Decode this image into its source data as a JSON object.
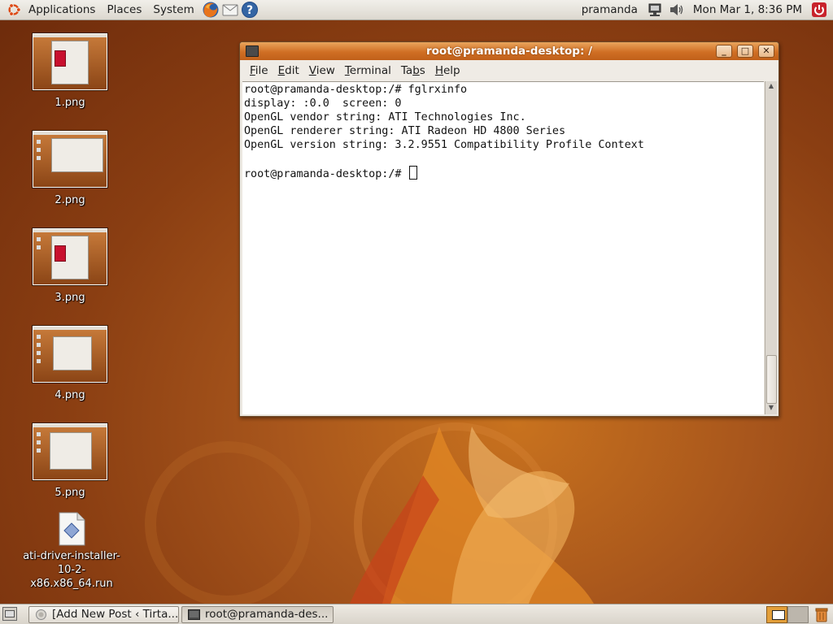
{
  "top_panel": {
    "menus": [
      "Applications",
      "Places",
      "System"
    ],
    "launchers": [
      "firefox-icon",
      "mail-icon",
      "help-icon"
    ],
    "username": "pramanda",
    "clock": "Mon Mar  1,  8:36 PM",
    "tray_icons": [
      "network-icon",
      "volume-icon",
      "power-icon"
    ]
  },
  "desktop_icons": [
    {
      "label": "1.png"
    },
    {
      "label": "2.png"
    },
    {
      "label": "3.png"
    },
    {
      "label": "4.png"
    },
    {
      "label": "5.png"
    },
    {
      "label": "ati-driver-installer-10-2-x86.x86_64.run"
    }
  ],
  "terminal": {
    "title": "root@pramanda-desktop: /",
    "buttons": {
      "minimize": "_",
      "maximize": "□",
      "close": "✕"
    },
    "menus": [
      {
        "label": "File",
        "mnemonic": "F",
        "rest": "ile"
      },
      {
        "label": "Edit",
        "mnemonic": "E",
        "rest": "dit"
      },
      {
        "label": "View",
        "mnemonic": "V",
        "rest": "iew"
      },
      {
        "label": "Terminal",
        "mnemonic": "T",
        "rest": "erminal"
      },
      {
        "label": "Tabs",
        "before": "Ta",
        "mnemonic": "b",
        "rest": "s"
      },
      {
        "label": "Help",
        "mnemonic": "H",
        "rest": "elp"
      }
    ],
    "lines": [
      "root@pramanda-desktop:/# fglrxinfo",
      "display: :0.0  screen: 0",
      "OpenGL vendor string: ATI Technologies Inc.",
      "OpenGL renderer string: ATI Radeon HD 4800 Series",
      "OpenGL version string: 3.2.9551 Compatibility Profile Context",
      "",
      "root@pramanda-desktop:/# "
    ]
  },
  "taskbar": {
    "tasks": [
      {
        "label": "[Add New Post ‹ Tirta...",
        "icon": "firefox-icon"
      },
      {
        "label": "root@pramanda-des...",
        "icon": "terminal-icon"
      }
    ],
    "workspaces": 2
  },
  "colors": {
    "titlebar": "#d06f24",
    "panel": "#e6e2db",
    "desktop": "#a8561c"
  }
}
